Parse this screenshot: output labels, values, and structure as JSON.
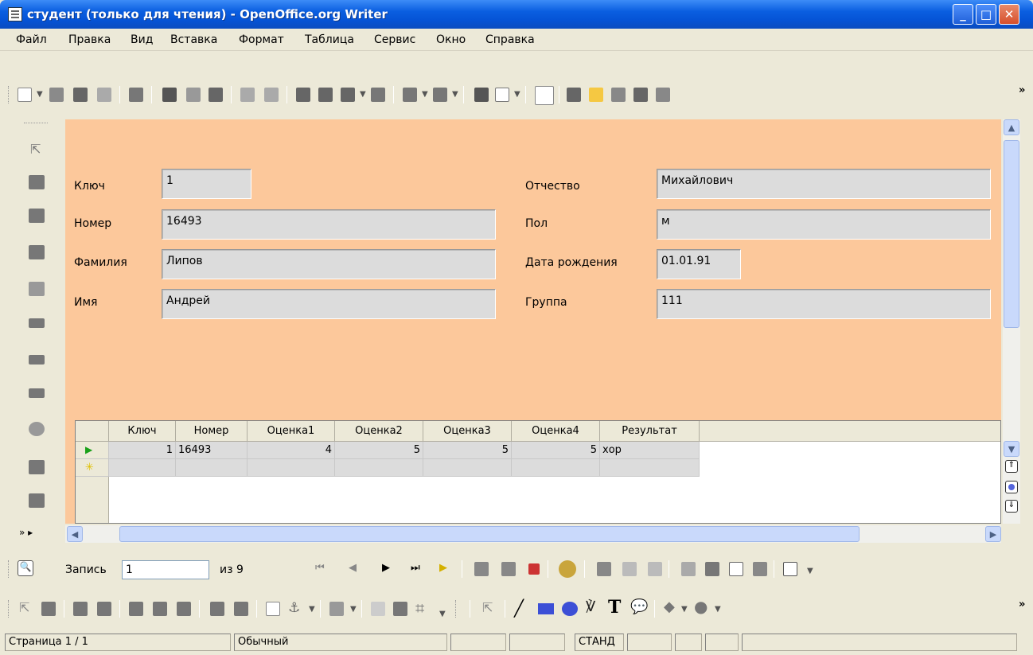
{
  "window": {
    "title": "студент (только для чтения) - OpenOffice.org Writer"
  },
  "menu": [
    "Файл",
    "Правка",
    "Вид",
    "Вставка",
    "Формат",
    "Таблица",
    "Сервис",
    "Окно",
    "Справка"
  ],
  "form": {
    "fields": [
      {
        "label": "Ключ",
        "value": "1"
      },
      {
        "label": "Номер",
        "value": "16493"
      },
      {
        "label": "Фамилия",
        "value": "Липов"
      },
      {
        "label": "Имя",
        "value": "Андрей"
      },
      {
        "label": "Отчество",
        "value": "Михайлович"
      },
      {
        "label": "Пол",
        "value": "м"
      },
      {
        "label": "Дата рождения",
        "value": "01.01.91"
      },
      {
        "label": "Группа",
        "value": "111"
      }
    ]
  },
  "grid": {
    "columns": [
      "Ключ",
      "Номер",
      "Оценка1",
      "Оценка2",
      "Оценка3",
      "Оценка4",
      "Результат"
    ],
    "rows": [
      [
        "1",
        "16493",
        "4",
        "5",
        "5",
        "5",
        "хор"
      ]
    ]
  },
  "navigation": {
    "record_label": "Запись",
    "record_value": "1",
    "of_label": "из 9"
  },
  "status": {
    "page": "Страница  1 / 1",
    "style": "Обычный",
    "mode": "СТАНД"
  },
  "colors": {
    "form_bg": "#fcc89b",
    "titlebar": "#0a5ee0"
  }
}
